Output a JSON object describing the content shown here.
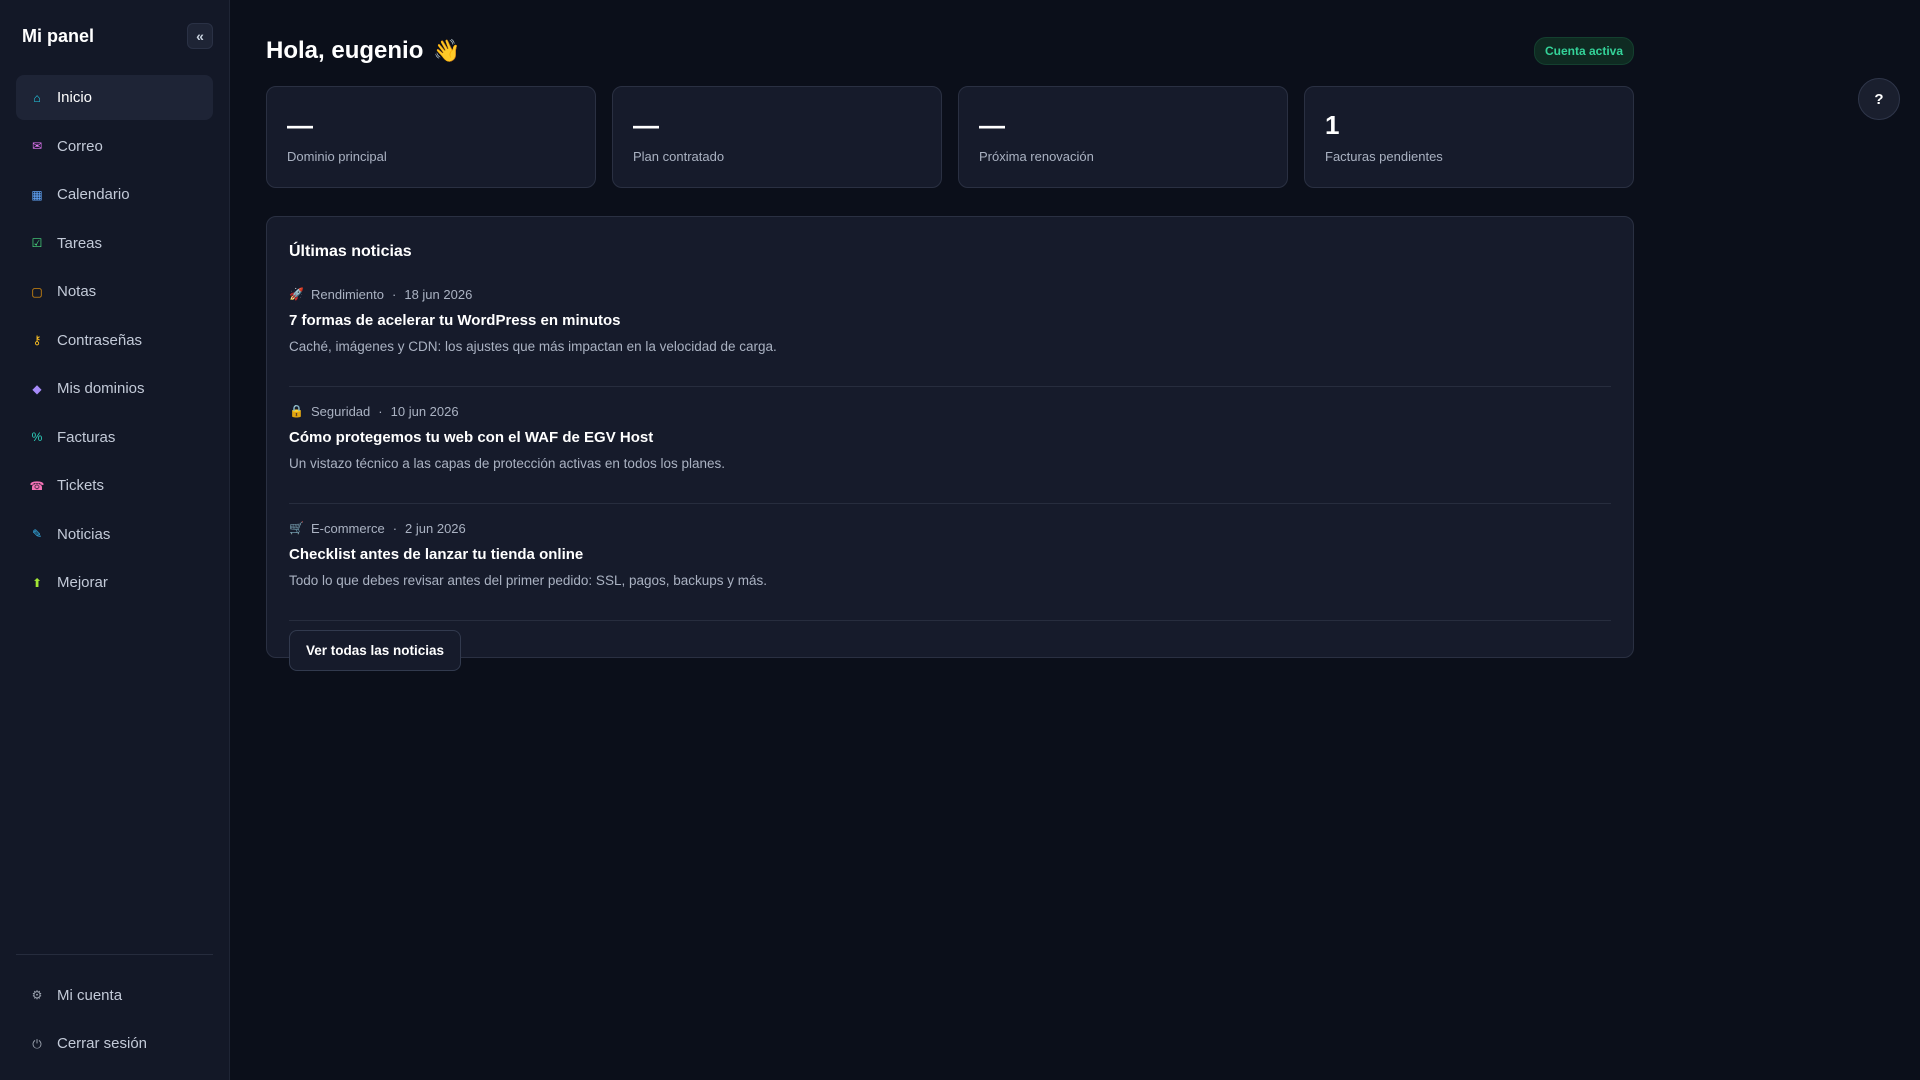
{
  "sidebar": {
    "title": "Mi panel",
    "collapse_label": "«",
    "items": [
      {
        "label": "Inicio",
        "icon": "home-icon",
        "glyph": "⌂",
        "color": "#22d3ee",
        "active": true
      },
      {
        "label": "Correo",
        "icon": "mail-icon",
        "glyph": "✉",
        "color": "#e879f9"
      },
      {
        "label": "Calendario",
        "icon": "calendar-icon",
        "glyph": "▦",
        "color": "#60a5fa"
      },
      {
        "label": "Tareas",
        "icon": "tasks-icon",
        "glyph": "☑",
        "color": "#4ade80"
      },
      {
        "label": "Notas",
        "icon": "notes-icon",
        "glyph": "▢",
        "color": "#f59e0b"
      },
      {
        "label": "Contraseñas",
        "icon": "key-icon",
        "glyph": "⚷",
        "color": "#fbbf24"
      },
      {
        "label": "Mis dominios",
        "icon": "diamond-icon",
        "glyph": "◆",
        "color": "#a78bfa"
      },
      {
        "label": "Facturas",
        "icon": "percent-icon",
        "glyph": "%",
        "color": "#2dd4bf"
      },
      {
        "label": "Tickets",
        "icon": "phone-icon",
        "glyph": "☎",
        "color": "#f472b6"
      },
      {
        "label": "Noticias",
        "icon": "pen-icon",
        "glyph": "✎",
        "color": "#38bdf8"
      },
      {
        "label": "Mejorar",
        "icon": "arrow-up-icon",
        "glyph": "⬆",
        "color": "#a3e635"
      }
    ],
    "bottom": [
      {
        "label": "Mi cuenta",
        "icon": "gear-icon",
        "glyph": "⚙",
        "color": "#9ca3af"
      },
      {
        "label": "Cerrar sesión",
        "icon": "power-icon",
        "glyph": "⏻",
        "color": "#9ca3af"
      }
    ]
  },
  "header": {
    "greeting": "Hola, eugenio",
    "wave_emoji": "👋",
    "status": "Cuenta activa"
  },
  "stats": [
    {
      "value": "—",
      "label": "Dominio principal"
    },
    {
      "value": "—",
      "label": "Plan contratado"
    },
    {
      "value": "—",
      "label": "Próxima renovación"
    },
    {
      "value": "1",
      "label": "Facturas pendientes"
    }
  ],
  "news": {
    "title": "Últimas noticias",
    "items": [
      {
        "icon": "rocket-icon",
        "glyph": "🚀",
        "category": "Rendimiento",
        "date": "18 jun 2026",
        "headline": "7 formas de acelerar tu WordPress en minutos",
        "description": "Caché, imágenes y CDN: los ajustes que más impactan en la velocidad de carga."
      },
      {
        "icon": "lock-icon",
        "glyph": "🔒",
        "category": "Seguridad",
        "date": "10 jun 2026",
        "headline": "Cómo protegemos tu web con el WAF de EGV Host",
        "description": "Un vistazo técnico a las capas de protección activas en todos los planes."
      },
      {
        "icon": "cash-register-icon",
        "glyph": "🛒",
        "category": "E-commerce",
        "date": "2 jun 2026",
        "headline": "Checklist antes de lanzar tu tienda online",
        "description": "Todo lo que debes revisar antes del primer pedido: SSL, pagos, backups y más."
      }
    ],
    "all_button": "Ver todas las noticias"
  },
  "help_label": "?"
}
